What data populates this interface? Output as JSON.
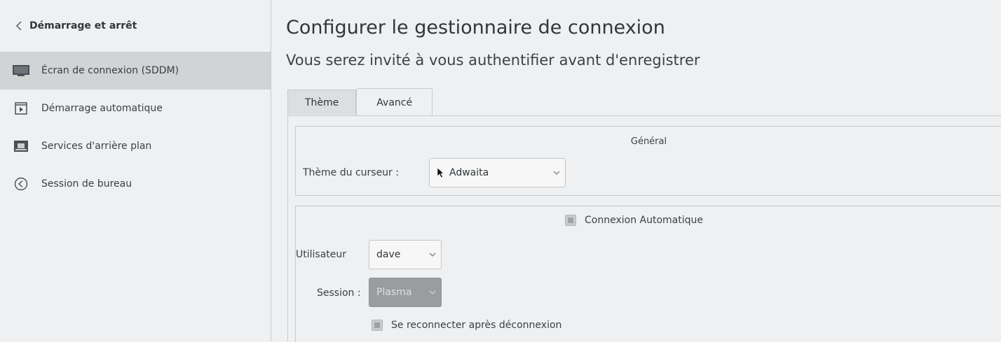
{
  "sidebar": {
    "header": "Démarrage et arrêt",
    "items": [
      {
        "label": "Écran de connexion (SDDM)",
        "icon": "monitor-icon",
        "active": true
      },
      {
        "label": "Démarrage automatique",
        "icon": "autostart-icon",
        "active": false
      },
      {
        "label": "Services d'arrière plan",
        "icon": "services-icon",
        "active": false
      },
      {
        "label": "Session de bureau",
        "icon": "session-icon",
        "active": false
      }
    ]
  },
  "main": {
    "title": "Configurer le gestionnaire de connexion",
    "subtitle": "Vous serez invité à vous authentifier avant d'enregistrer",
    "tabs": [
      {
        "label": "Thème",
        "active": false
      },
      {
        "label": "Avancé",
        "active": true
      }
    ],
    "general": {
      "title": "Général",
      "cursor_theme_label": "Thème du curseur :",
      "cursor_theme_value": "Adwaita"
    },
    "autologin": {
      "checkbox_label": "Connexion Automatique",
      "user_label": "Utilisateur",
      "user_value": "dave",
      "session_label": "Session :",
      "session_value": "Plasma",
      "reconnect_label": "Se reconnecter après déconnexion"
    }
  },
  "colors": {
    "active_item_bg": "#d1d3d5",
    "disabled_combo_bg": "#9a9c9e",
    "window_bg": "#eff0f1"
  }
}
